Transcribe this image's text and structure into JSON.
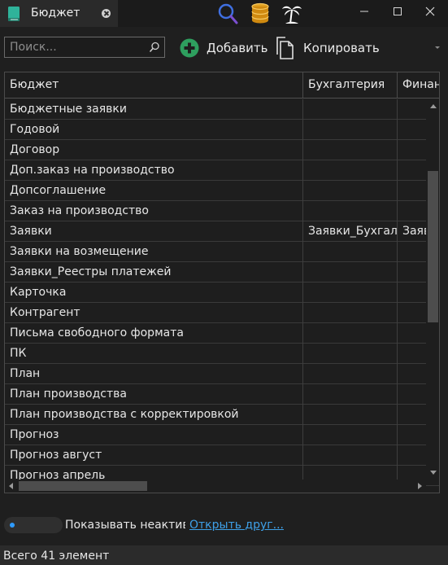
{
  "window": {
    "tab_title": "Бюджет"
  },
  "toolbar": {
    "search_placeholder": "Поиск...",
    "add_label": "Добавить",
    "copy_label": "Копировать"
  },
  "grid": {
    "columns": [
      "Бюджет",
      "Бухгалтерия",
      "Финан"
    ],
    "rows": [
      [
        "Бюджетные заявки",
        "",
        ""
      ],
      [
        "Годовой",
        "",
        ""
      ],
      [
        "Договор",
        "",
        ""
      ],
      [
        "Доп.заказ на производство",
        "",
        ""
      ],
      [
        "Допсоглашение",
        "",
        ""
      ],
      [
        "Заказ на производство",
        "",
        ""
      ],
      [
        "Заявки",
        "Заявки_Бухгалт",
        "Заяв"
      ],
      [
        "Заявки на возмещение",
        "",
        ""
      ],
      [
        "Заявки_Реестры платежей",
        "",
        ""
      ],
      [
        "Карточка",
        "",
        ""
      ],
      [
        "Контрагент",
        "",
        ""
      ],
      [
        "Письма свободного формата",
        "",
        ""
      ],
      [
        "ПК",
        "",
        ""
      ],
      [
        "План",
        "",
        ""
      ],
      [
        "План производства",
        "",
        ""
      ],
      [
        "План производства с корректировкой",
        "",
        ""
      ],
      [
        "Прогноз",
        "",
        ""
      ],
      [
        "Прогноз август",
        "",
        ""
      ],
      [
        "Прогноз апрель",
        "",
        ""
      ]
    ]
  },
  "footer": {
    "show_inactive_label": "Показывать неактив",
    "open_link": "Открыть друг...",
    "status": "Всего 41 элемент"
  },
  "colors": {
    "accent_blue": "#2e9bff",
    "link": "#3ea0e8",
    "add_green": "#2e9e5e",
    "tab_icon": "#2fb39a",
    "search_tool": "#3f6fe0",
    "database_tool": "#e0a020"
  }
}
